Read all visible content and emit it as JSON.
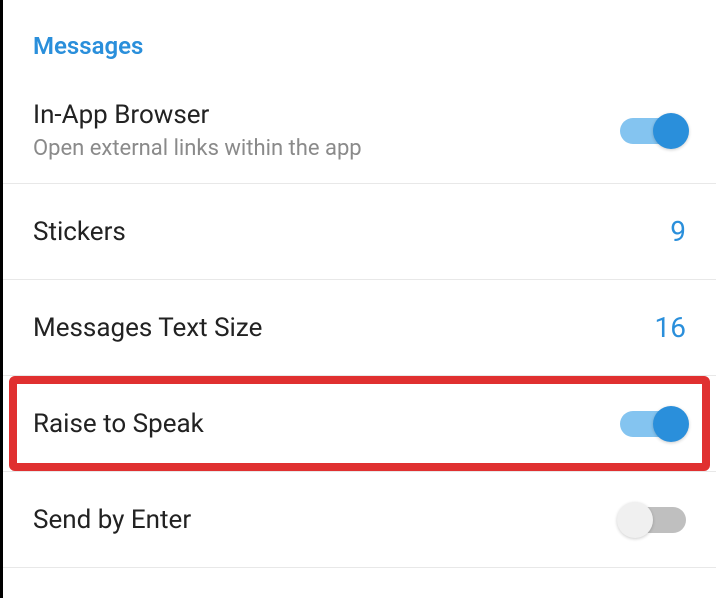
{
  "section": {
    "header": "Messages"
  },
  "rows": {
    "inapp": {
      "title": "In-App Browser",
      "subtitle": "Open external links within the app",
      "toggle_on": true
    },
    "stickers": {
      "title": "Stickers",
      "value": "9"
    },
    "textsize": {
      "title": "Messages Text Size",
      "value": "16"
    },
    "raise": {
      "title": "Raise to Speak",
      "toggle_on": true
    },
    "sendenter": {
      "title": "Send by Enter",
      "toggle_on": false
    }
  }
}
